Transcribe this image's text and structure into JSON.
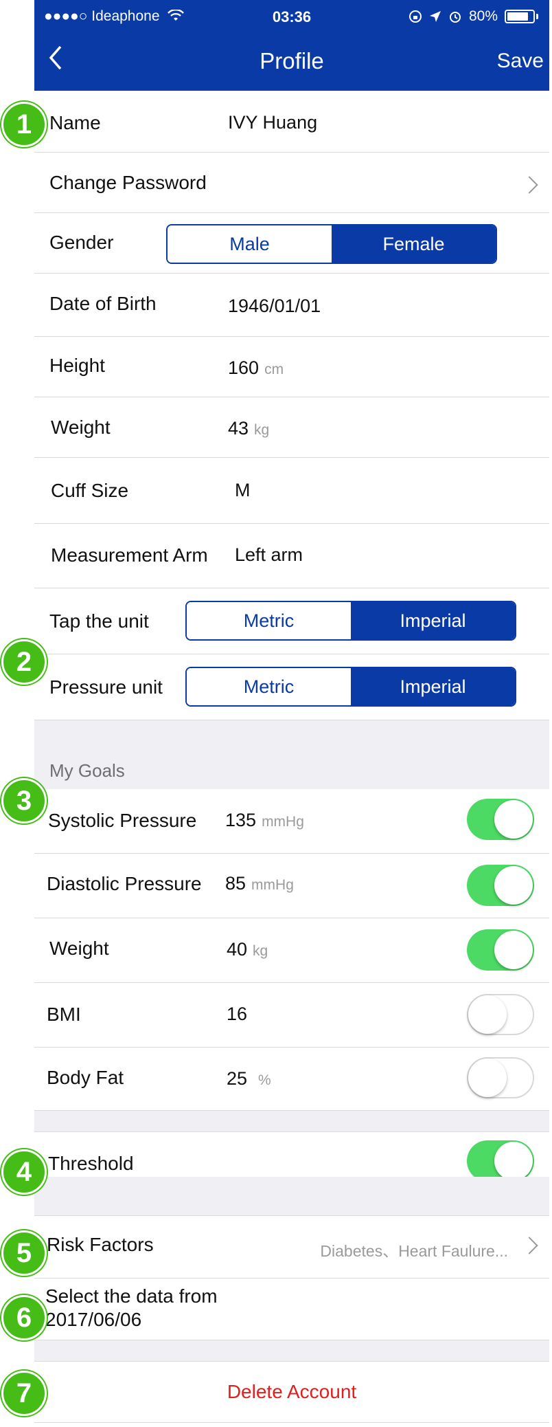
{
  "status_bar": {
    "carrier": "●●●●○ Ideaphone",
    "time": "03:36",
    "battery": "80%"
  },
  "nav": {
    "title": "Profile",
    "save_label": "Save"
  },
  "profile": {
    "name_label": "Name",
    "name_value": "IVY Huang",
    "change_password_label": "Change Password",
    "gender_label": "Gender",
    "gender_options": [
      "Male",
      "Female"
    ],
    "gender_selected": "Female",
    "dob_label": "Date of Birth",
    "dob_value": "1946/01/01",
    "height_label": "Height",
    "height_value": "160",
    "height_unit": "cm",
    "weight_label": "Weight",
    "weight_value": "43",
    "weight_unit": "kg",
    "cuff_label": "Cuff Size",
    "cuff_value": "M",
    "arm_label": "Measurement Arm",
    "arm_value": "Left arm",
    "tap_unit_label": "Tap the unit",
    "tap_unit_options": [
      "Metric",
      "Imperial"
    ],
    "tap_unit_selected": "Imperial",
    "pressure_unit_label": "Pressure unit",
    "pressure_unit_options": [
      "Metric",
      "Imperial"
    ],
    "pressure_unit_selected": "Imperial"
  },
  "goals": {
    "section_title": "My Goals",
    "items": [
      {
        "label": "Systolic Pressure",
        "value": "135",
        "unit": "mmHg",
        "enabled": true
      },
      {
        "label": "Diastolic Pressure",
        "value": "85",
        "unit": "mmHg",
        "enabled": true
      },
      {
        "label": "Weight",
        "value": "40",
        "unit": "kg",
        "enabled": true
      },
      {
        "label": "BMI",
        "value": "16",
        "unit": "",
        "enabled": false
      },
      {
        "label": "Body Fat",
        "value": "25",
        "unit": "%",
        "enabled": false
      }
    ]
  },
  "threshold": {
    "label": "Threshold",
    "enabled": true
  },
  "risk_factors": {
    "label": "Risk Factors",
    "value": "Diabetes、Heart Faulure..."
  },
  "select_data": {
    "line1": "Select the data from",
    "line2": "2017/06/06"
  },
  "delete_account": {
    "label": "Delete Account"
  },
  "badges": [
    "1",
    "2",
    "3",
    "4",
    "5",
    "6",
    "7"
  ],
  "colors": {
    "nav_blue": "#0a3aa5",
    "toggle_green": "#4cd964",
    "badge_green": "#46bd17",
    "delete_red": "#e02020"
  }
}
